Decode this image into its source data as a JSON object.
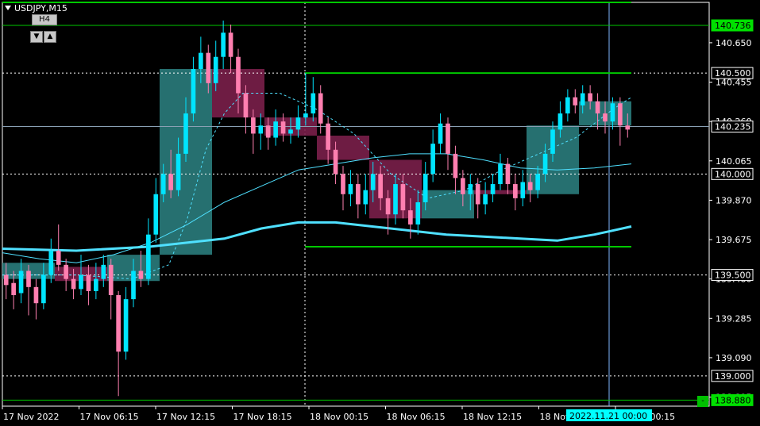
{
  "window": {
    "title": "USDJPY,M15"
  },
  "timeframe_box": {
    "label": "H4",
    "down": "▼",
    "up": "▲"
  },
  "corner_button": {
    "label": "-"
  },
  "colors": {
    "background": "#000000",
    "bull_candle": "#00e5ff",
    "bear_candle": "#ff7fb0",
    "bull_box": "#2a7c7c",
    "bear_box": "#7a1f4a",
    "level_line": "#00c800",
    "thin_line": "#7fb6ff",
    "ma_line": "#4fe0ff",
    "tag_green": "#00e000",
    "tag_cyan": "#00ffff"
  },
  "chart_data": {
    "type": "candlestick",
    "symbol": "USDJPY",
    "timeframe": "M15",
    "ylim": [
      138.85,
      140.85
    ],
    "price_ticks": [
      "140.650",
      "140.455",
      "140.260",
      "140.065",
      "139.870",
      "139.675",
      "139.480",
      "139.285",
      "139.090",
      "138.895"
    ],
    "tick_values": [
      140.65,
      140.455,
      140.26,
      140.065,
      139.87,
      139.675,
      139.48,
      139.285,
      139.09,
      138.895
    ],
    "time_labels": [
      "17 Nov 2022",
      "17 Nov 06:15",
      "17 Nov 12:15",
      "17 Nov 18:15",
      "18 Nov 00:15",
      "18 Nov 06:15",
      "18 Nov 12:15",
      "18 Nov 18:15",
      "21 Nov 00:15"
    ],
    "cursor_time_label": "2022.11.21 00:00",
    "price_tags": [
      {
        "value": 140.736,
        "label": "140.736",
        "style": "green"
      },
      {
        "value": 140.5,
        "label": "140.500",
        "style": "outline"
      },
      {
        "value": 140.235,
        "label": "140.235",
        "style": "outline"
      },
      {
        "value": 140.0,
        "label": "140.000",
        "style": "outline"
      },
      {
        "value": 139.5,
        "label": "139.500",
        "style": "outline"
      },
      {
        "value": 139.0,
        "label": "139.000",
        "style": "outline"
      },
      {
        "value": 138.88,
        "label": "138.880",
        "style": "green"
      }
    ],
    "level_lines": [
      140.736,
      140.5,
      140.0,
      139.5,
      139.0,
      138.88
    ],
    "day_separators": [
      "17 Nov 2022",
      "18 Nov 00:15"
    ],
    "ma_fast": [
      [
        0,
        139.61
      ],
      [
        20,
        139.58
      ],
      [
        40,
        139.56
      ],
      [
        60,
        139.6
      ],
      [
        80,
        139.66
      ],
      [
        100,
        139.75
      ],
      [
        120,
        139.86
      ],
      [
        140,
        139.94
      ],
      [
        160,
        140.02
      ],
      [
        180,
        140.05
      ],
      [
        200,
        140.08
      ],
      [
        220,
        140.1
      ],
      [
        240,
        140.1
      ],
      [
        260,
        140.07
      ],
      [
        280,
        140.03
      ],
      [
        300,
        140.02
      ],
      [
        320,
        140.03
      ],
      [
        340,
        140.05
      ]
    ],
    "ma_slow": [
      [
        0,
        139.63
      ],
      [
        40,
        139.62
      ],
      [
        80,
        139.64
      ],
      [
        120,
        139.68
      ],
      [
        140,
        139.73
      ],
      [
        160,
        139.76
      ],
      [
        180,
        139.76
      ],
      [
        200,
        139.74
      ],
      [
        220,
        139.72
      ],
      [
        240,
        139.7
      ],
      [
        260,
        139.69
      ],
      [
        280,
        139.68
      ],
      [
        300,
        139.67
      ],
      [
        320,
        139.7
      ],
      [
        340,
        139.74
      ]
    ],
    "ma_dash": [
      [
        0,
        139.5
      ],
      [
        40,
        139.5
      ],
      [
        70,
        139.48
      ],
      [
        90,
        139.55
      ],
      [
        100,
        139.78
      ],
      [
        110,
        140.12
      ],
      [
        120,
        140.3
      ],
      [
        130,
        140.4
      ],
      [
        150,
        140.4
      ],
      [
        170,
        140.32
      ],
      [
        190,
        140.2
      ],
      [
        210,
        140.0
      ],
      [
        230,
        139.88
      ],
      [
        250,
        139.92
      ],
      [
        270,
        140.02
      ],
      [
        290,
        140.1
      ],
      [
        310,
        140.18
      ],
      [
        330,
        140.32
      ],
      [
        340,
        140.38
      ]
    ],
    "htf_boxes": [
      {
        "from": 0,
        "to": 24,
        "open": 139.48,
        "close": 139.56,
        "dir": "bull"
      },
      {
        "from": 24,
        "to": 48,
        "open": 139.54,
        "close": 139.47,
        "dir": "bear"
      },
      {
        "from": 48,
        "to": 72,
        "open": 139.47,
        "close": 139.6,
        "dir": "bull"
      },
      {
        "from": 72,
        "to": 96,
        "open": 139.6,
        "close": 140.52,
        "dir": "bull"
      },
      {
        "from": 96,
        "to": 120,
        "open": 140.52,
        "close": 140.28,
        "dir": "bear"
      },
      {
        "from": 120,
        "to": 144,
        "open": 140.28,
        "close": 140.19,
        "dir": "bear"
      },
      {
        "from": 144,
        "to": 168,
        "open": 140.19,
        "close": 140.07,
        "dir": "bear"
      },
      {
        "from": 168,
        "to": 192,
        "open": 140.07,
        "close": 139.78,
        "dir": "bear"
      },
      {
        "from": 192,
        "to": 216,
        "open": 139.78,
        "close": 139.92,
        "dir": "bull"
      },
      {
        "from": 216,
        "to": 240,
        "open": 139.92,
        "close": 139.9,
        "dir": "bear"
      },
      {
        "from": 240,
        "to": 264,
        "open": 139.9,
        "close": 140.24,
        "dir": "bull"
      },
      {
        "from": 264,
        "to": 288,
        "open": 140.24,
        "close": 140.36,
        "dir": "bull"
      }
    ],
    "candles": [
      [
        139.5,
        139.45,
        139.56,
        139.38
      ],
      [
        139.46,
        139.4,
        139.52,
        139.33
      ],
      [
        139.41,
        139.52,
        139.58,
        139.36
      ],
      [
        139.52,
        139.44,
        139.55,
        139.3
      ],
      [
        139.44,
        139.36,
        139.48,
        139.28
      ],
      [
        139.36,
        139.5,
        139.56,
        139.33
      ],
      [
        139.5,
        139.62,
        139.68,
        139.46
      ],
      [
        139.62,
        139.55,
        139.75,
        139.52
      ],
      [
        139.55,
        139.48,
        139.58,
        139.42
      ],
      [
        139.48,
        139.43,
        139.53,
        139.38
      ],
      [
        139.43,
        139.5,
        139.6,
        139.4
      ],
      [
        139.5,
        139.42,
        139.55,
        139.35
      ],
      [
        139.42,
        139.48,
        139.56,
        139.38
      ],
      [
        139.48,
        139.55,
        139.6,
        139.44
      ],
      [
        139.55,
        139.4,
        139.58,
        139.28
      ],
      [
        139.4,
        139.12,
        139.42,
        138.9
      ],
      [
        139.12,
        139.38,
        139.44,
        139.08
      ],
      [
        139.38,
        139.52,
        139.58,
        139.34
      ],
      [
        139.52,
        139.48,
        139.62,
        139.44
      ],
      [
        139.48,
        139.7,
        139.78,
        139.45
      ],
      [
        139.7,
        139.9,
        139.98,
        139.66
      ],
      [
        139.9,
        140.0,
        140.05,
        139.86
      ],
      [
        140.0,
        139.92,
        140.12,
        139.88
      ],
      [
        139.92,
        140.1,
        140.18,
        139.89
      ],
      [
        140.1,
        140.3,
        140.38,
        140.06
      ],
      [
        140.3,
        140.52,
        140.58,
        140.26
      ],
      [
        140.52,
        140.6,
        140.68,
        140.45
      ],
      [
        140.6,
        140.45,
        140.64,
        140.4
      ],
      [
        140.45,
        140.58,
        140.66,
        140.41
      ],
      [
        140.58,
        140.7,
        140.76,
        140.52
      ],
      [
        140.7,
        140.58,
        140.74,
        140.5
      ],
      [
        140.58,
        140.4,
        140.62,
        140.3
      ],
      [
        140.4,
        140.28,
        140.44,
        140.2
      ],
      [
        140.28,
        140.2,
        140.32,
        140.1
      ],
      [
        140.2,
        140.24,
        140.3,
        140.12
      ],
      [
        140.24,
        140.18,
        140.28,
        140.12
      ],
      [
        140.18,
        140.26,
        140.32,
        140.14
      ],
      [
        140.26,
        140.2,
        140.3,
        140.16
      ],
      [
        140.2,
        140.22,
        140.28,
        140.15
      ],
      [
        140.22,
        140.28,
        140.34,
        140.18
      ],
      [
        140.28,
        140.3,
        140.5,
        140.24
      ],
      [
        140.3,
        140.4,
        140.48,
        140.26
      ],
      [
        140.4,
        140.25,
        140.44,
        140.2
      ],
      [
        140.25,
        140.12,
        140.28,
        140.05
      ],
      [
        140.12,
        140.0,
        140.16,
        139.95
      ],
      [
        140.0,
        139.9,
        140.04,
        139.82
      ],
      [
        139.9,
        139.95,
        140.02,
        139.84
      ],
      [
        139.95,
        139.85,
        140.0,
        139.78
      ],
      [
        139.85,
        139.92,
        140.0,
        139.8
      ],
      [
        139.92,
        140.0,
        140.06,
        139.86
      ],
      [
        140.0,
        139.88,
        140.04,
        139.82
      ],
      [
        139.88,
        139.8,
        139.92,
        139.7
      ],
      [
        139.8,
        139.95,
        140.0,
        139.75
      ],
      [
        139.95,
        139.82,
        140.0,
        139.78
      ],
      [
        139.82,
        139.75,
        139.88,
        139.68
      ],
      [
        139.75,
        139.86,
        139.92,
        139.7
      ],
      [
        139.86,
        140.0,
        140.06,
        139.82
      ],
      [
        140.0,
        140.15,
        140.22,
        139.96
      ],
      [
        140.15,
        140.25,
        140.3,
        140.1
      ],
      [
        140.25,
        140.1,
        140.28,
        140.02
      ],
      [
        140.1,
        139.98,
        140.14,
        139.9
      ],
      [
        139.98,
        139.9,
        140.02,
        139.84
      ],
      [
        139.9,
        139.95,
        140.0,
        139.82
      ],
      [
        139.95,
        139.85,
        139.98,
        139.78
      ],
      [
        139.85,
        139.9,
        139.96,
        139.8
      ],
      [
        139.9,
        139.95,
        140.0,
        139.86
      ],
      [
        139.95,
        140.05,
        140.1,
        139.92
      ],
      [
        140.05,
        139.95,
        140.08,
        139.9
      ],
      [
        139.95,
        139.88,
        140.0,
        139.82
      ],
      [
        139.88,
        139.96,
        140.02,
        139.84
      ],
      [
        139.96,
        139.92,
        140.0,
        139.86
      ],
      [
        139.92,
        140.0,
        140.04,
        139.88
      ],
      [
        140.0,
        140.1,
        140.15,
        139.96
      ],
      [
        140.1,
        140.22,
        140.26,
        140.06
      ],
      [
        140.22,
        140.3,
        140.36,
        140.18
      ],
      [
        140.3,
        140.38,
        140.42,
        140.26
      ],
      [
        140.38,
        140.34,
        140.42,
        140.3
      ],
      [
        140.34,
        140.4,
        140.44,
        140.3
      ],
      [
        140.4,
        140.36,
        140.44,
        140.32
      ],
      [
        140.36,
        140.3,
        140.4,
        140.22
      ],
      [
        140.3,
        140.26,
        140.36,
        140.2
      ],
      [
        140.26,
        140.35,
        140.38,
        140.22
      ],
      [
        140.35,
        140.24,
        140.38,
        140.14
      ],
      [
        140.24,
        140.22,
        140.3,
        140.18
      ]
    ]
  }
}
